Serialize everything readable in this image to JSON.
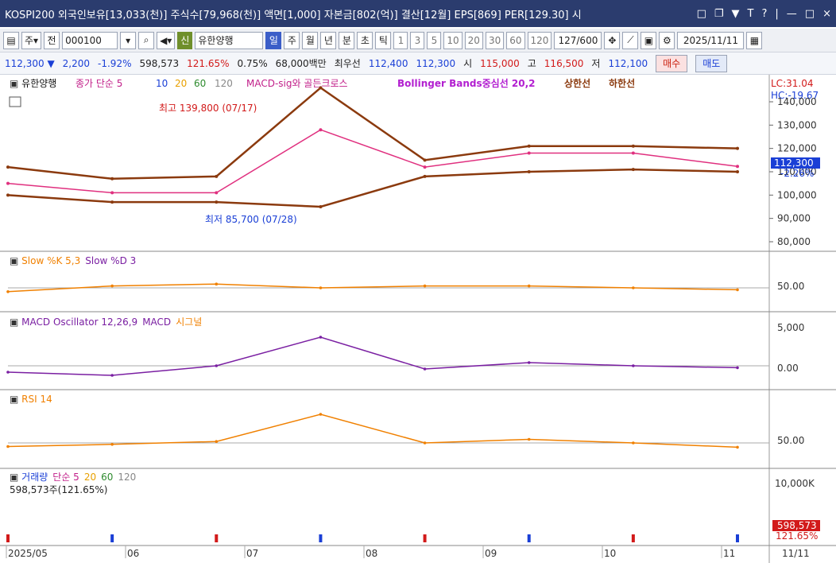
{
  "window": {
    "title": "KOSPI200 외국인보유[13,033(천)] 주식수[79,968(천)] 액면[1,000] 자본금[802(억)] 결산[12월] EPS[869] PER[129.30] 시",
    "buttons": [
      "□",
      "❐",
      "▼",
      "T",
      "?",
      "|",
      "—",
      "□",
      "×"
    ]
  },
  "toolbar": {
    "type_label": "주",
    "jeon_label": "전",
    "code_value": "000100",
    "shin_label": "신",
    "stock_name": "유한양행",
    "periods": [
      "일",
      "주",
      "월",
      "년",
      "분",
      "초",
      "틱"
    ],
    "active_period": "일",
    "numbers": [
      "1",
      "3",
      "5",
      "10",
      "20",
      "30",
      "60",
      "120"
    ],
    "count_value": "127",
    "count_total": "/600",
    "date_value": "2025/11/11"
  },
  "quote": {
    "price": "112,300 ▼",
    "change": "2,200",
    "change_rate": "-1.92%",
    "volume": "598,573",
    "volume_ratio": "121.65%",
    "turnover": "0.75%",
    "amount": "68,000백만",
    "best_label": "최우선",
    "best_ask": "112,400",
    "best_bid": "112,300",
    "open_label": "시",
    "open": "115,000",
    "high_label": "고",
    "high": "116,500",
    "low_label": "저",
    "low": "112,100",
    "buy_label": "매수",
    "sell_label": "매도"
  },
  "panels": {
    "price_legend": {
      "name": "유한양행",
      "ma_label": "종가 단순 5",
      "ma_periods": [
        "10",
        "20",
        "60",
        "120"
      ],
      "macd_label": "MACD-sig와 골든크로스",
      "bb_label": "Bollinger Bands중심선 20,2",
      "upper_label": "상한선",
      "lower_label": "하한선",
      "lc": "LC:31.04",
      "hc": "HC:-19.67",
      "high_note": "최고 139,800 (07/17)",
      "low_note": "최저 85,700 (07/28)",
      "last_price": "112,300",
      "last_rate": "-2.26%",
      "ticks": [
        "140,000",
        "130,000",
        "120,000",
        "110,000",
        "100,000",
        "90,000",
        "80,000"
      ]
    },
    "stoch_legend": {
      "k": "Slow %K 5,3",
      "d": "Slow %D 3",
      "tick": "50.00"
    },
    "macd_legend": {
      "osc": "MACD Oscillator 12,26,9",
      "macd": "MACD",
      "signal": "시그널",
      "ticks": [
        "5,000",
        "0.00"
      ]
    },
    "rsi_legend": {
      "label": "RSI 14",
      "tick": "50.00"
    },
    "vol_legend": {
      "label": "거래량",
      "ma": "단순 5",
      "ma2": "20",
      "ma3": "60",
      "ma4": "120",
      "value": "598,573주(121.65%)",
      "tick": "10,000K",
      "last": "598,573",
      "last_rate": "121.65%"
    }
  },
  "xaxis": {
    "labels": [
      "2025/05",
      "06",
      "07",
      "08",
      "09",
      "10",
      "11"
    ],
    "right_label": "11/11"
  },
  "colors": {
    "titlebar": "#2b3c6e",
    "up": "#d21a1a",
    "down": "#1a3fd6",
    "bb": "#8b3a0e",
    "ma5": "#e0307f",
    "ma10": "#1a3fd6",
    "ma20": "#f08000",
    "ma60": "#2e8b2e",
    "ma120": "#888888"
  },
  "chart_data": {
    "type": "line",
    "title": "유한양행",
    "x": [
      "2025/05",
      "06",
      "07",
      "08",
      "09",
      "10",
      "11",
      "11/11"
    ],
    "series": [
      {
        "name": "유한양행",
        "values": [
          105000,
          101000,
          101000,
          128000,
          112000,
          118000,
          118000,
          112300
        ]
      },
      {
        "name": "상한선",
        "values": [
          112000,
          107000,
          108000,
          146000,
          115000,
          121000,
          121000,
          120000
        ]
      },
      {
        "name": "하한선",
        "values": [
          100000,
          97000,
          97000,
          95000,
          108000,
          110000,
          111000,
          110000
        ]
      },
      {
        "name": "Slow %K 5,3",
        "values": [
          40,
          55,
          60,
          50,
          55,
          55,
          50,
          45
        ]
      },
      {
        "name": "MACD Oscillator 12,26,9",
        "values": [
          -1000,
          -1500,
          0,
          4500,
          -500,
          500,
          0,
          -300
        ]
      },
      {
        "name": "RSI 14",
        "values": [
          45,
          48,
          52,
          90,
          50,
          55,
          50,
          44
        ]
      }
    ],
    "ylim": [
      80000,
      140000
    ]
  }
}
